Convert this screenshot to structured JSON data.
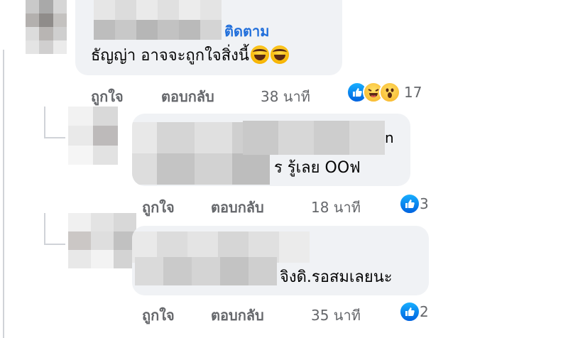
{
  "comments": [
    {
      "follow_label": "ติดตาม",
      "text": "ธัญญ่า อาจจะถูกใจสิ่งนี้",
      "actions": {
        "like": "ถูกใจ",
        "reply": "ตอบกลับ",
        "time": "38 นาที"
      },
      "reactions": [
        "like-icon",
        "haha-icon",
        "wow-icon"
      ],
      "reaction_count": "17"
    },
    {
      "fragment_top": "n",
      "text": "ร รู้เลย OOฟ",
      "actions": {
        "like": "ถูกใจ",
        "reply": "ตอบกลับ",
        "time": "18 นาที"
      },
      "reactions": [
        "like-icon"
      ],
      "reaction_count": "3"
    },
    {
      "text": "จิงดิ.รอสมเลยนะ",
      "actions": {
        "like": "ถูกใจ",
        "reply": "ตอบกลับ",
        "time": "35 นาที"
      },
      "reactions": [
        "like-icon"
      ],
      "reaction_count": "2"
    }
  ],
  "colors": {
    "bubble": "#f0f2f5",
    "link_blue": "#216fdb",
    "meta_gray": "#65676b",
    "like_blue": "#0866ff"
  }
}
